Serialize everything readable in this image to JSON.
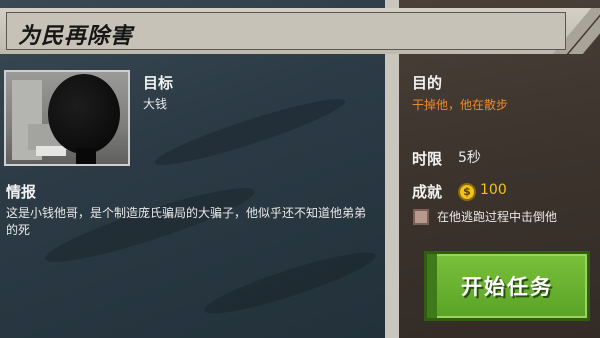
{
  "header": {
    "title": "为民再除害"
  },
  "target": {
    "label": "目标",
    "name": "大钱"
  },
  "intel": {
    "label": "情报",
    "text": "这是小钱他哥，是个制造庞氏骗局的大骗子，他似乎还不知道他弟弟的死"
  },
  "objective": {
    "label": "目的",
    "text": "干掉他，他在散步"
  },
  "time_limit": {
    "label": "时限",
    "value": "5秒"
  },
  "achievement": {
    "label": "成就",
    "coin_icon": "coin-icon",
    "reward": "100",
    "condition": "在他逃跑过程中击倒他"
  },
  "start_button": {
    "label": "开始任务"
  },
  "colors": {
    "accent_orange": "#f08a2a",
    "button_green": "#6bb332"
  }
}
